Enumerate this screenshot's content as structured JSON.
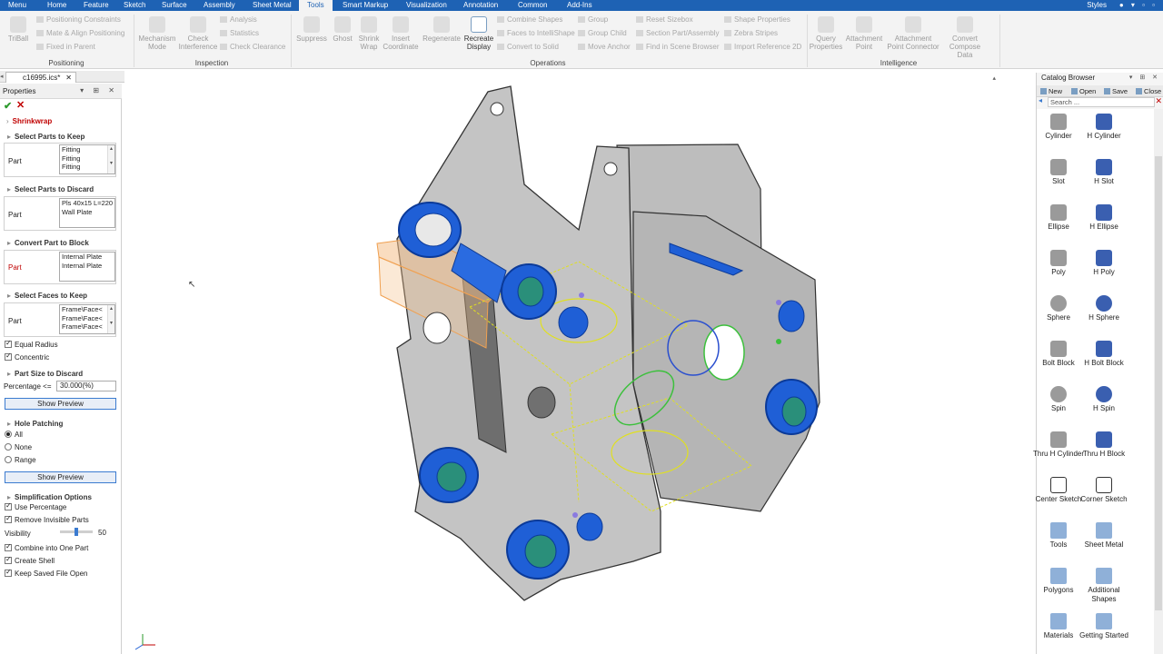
{
  "menubar": {
    "items": [
      "Menu",
      "Home",
      "Feature",
      "Sketch",
      "Surface",
      "Assembly",
      "Sheet Metal",
      "Tools",
      "Smart Markup",
      "Visualization",
      "Annotation",
      "Common",
      "Add-Ins"
    ],
    "active": "Tools",
    "styles_label": "Styles"
  },
  "ribbon": {
    "trball_label": "TriBall",
    "positioning_small": [
      "Positioning Constraints",
      "Mate & Align Positioning",
      "Fixed in Parent"
    ],
    "positioning_group": "Positioning",
    "mechanism_label": "Mechanism Mode",
    "check_interference_label": "Check Interference",
    "inspection_small": [
      "Analysis",
      "Statistics",
      "Check Clearance"
    ],
    "inspection_group": "Inspection",
    "operations_large": [
      "Suppress",
      "Ghost",
      "Shrink Wrap",
      "Insert Coordinate",
      "Regenerate",
      "Recreate Display"
    ],
    "operations_small_col1": [
      "Combine Shapes",
      "Faces to IntelliShape",
      "Convert to Solid"
    ],
    "operations_small_col2": [
      "Group",
      "Group Child",
      "Move Anchor"
    ],
    "operations_small_col3": [
      "Reset Sizebox",
      "Section Part/Assembly",
      "Find in Scene Browser"
    ],
    "operations_small_col4": [
      "Shape Properties",
      "Zebra Stripes",
      "Import Reference 2D"
    ],
    "operations_group": "Operations",
    "intelligence_large": [
      "Query Properties",
      "Attachment Point",
      "Attachment Point Connector",
      "Convert Compose Data"
    ],
    "intelligence_group": "Intelligence"
  },
  "document": {
    "tab_name": "c16995.ics*"
  },
  "properties": {
    "title": "Properties",
    "command_title": "Shrinkwrap",
    "keep_parts": {
      "header": "Select Parts to Keep",
      "label": "Part",
      "items": [
        "Fitting",
        "Fitting",
        "Fitting"
      ]
    },
    "discard_parts": {
      "header": "Select Parts to Discard",
      "label": "Part",
      "items": [
        "Pls 40x15 L=220",
        "Wall Plate"
      ]
    },
    "convert_block": {
      "header": "Convert Part to Block",
      "label": "Part",
      "items": [
        "Internal Plate",
        "Internal Plate"
      ]
    },
    "keep_faces": {
      "header": "Select Faces to Keep",
      "label": "Part",
      "items": [
        "Frame\\Face<",
        "Frame\\Face<",
        "Frame\\Face<"
      ]
    },
    "equal_radius": "Equal Radius",
    "concentric": "Concentric",
    "part_size": {
      "header": "Part Size to Discard",
      "label": "Percentage <=",
      "value": "30.000(%)"
    },
    "show_preview": "Show Preview",
    "hole_patching": {
      "header": "Hole Patching",
      "options": [
        "All",
        "None",
        "Range"
      ],
      "selected": "All"
    },
    "simplification": {
      "header": "Simplification Options",
      "use_percentage": "Use Percentage",
      "remove_invisible": "Remove Invisible Parts",
      "visibility_label": "Visibility",
      "visibility_value": "50",
      "visibility_fraction": 0.5,
      "combine": "Combine into One Part",
      "create_shell": "Create Shell",
      "keep_saved": "Keep Saved File Open"
    }
  },
  "catalog": {
    "title": "Catalog Browser",
    "toolbar": [
      "New",
      "Open",
      "Save",
      "Close"
    ],
    "search_placeholder": "Search ...",
    "items": [
      [
        "Cylinder",
        "H Cylinder"
      ],
      [
        "Slot",
        "H Slot"
      ],
      [
        "Ellipse",
        "H Ellipse"
      ],
      [
        "Poly",
        "H Poly"
      ],
      [
        "Sphere",
        "H Sphere"
      ],
      [
        "Bolt Block",
        "H Bolt Block"
      ],
      [
        "Spin",
        "H Spin"
      ],
      [
        "Thru H Cylinder",
        "Thru H Block"
      ],
      [
        "Center Sketch",
        "Corner Sketch"
      ],
      [
        "Tools",
        "Sheet Metal"
      ],
      [
        "Polygons",
        "Additional Shapes"
      ],
      [
        "Materials",
        "Getting Started"
      ]
    ]
  },
  "colors": {
    "menubar": "#1e62b4",
    "plate": "#b9b9b9",
    "fitting": "#1f5fd6",
    "outline_selected": "#e0e020",
    "highlight_orange": "#f0a050",
    "highlight_green": "#3cc03c",
    "error_red": "#c00000"
  }
}
